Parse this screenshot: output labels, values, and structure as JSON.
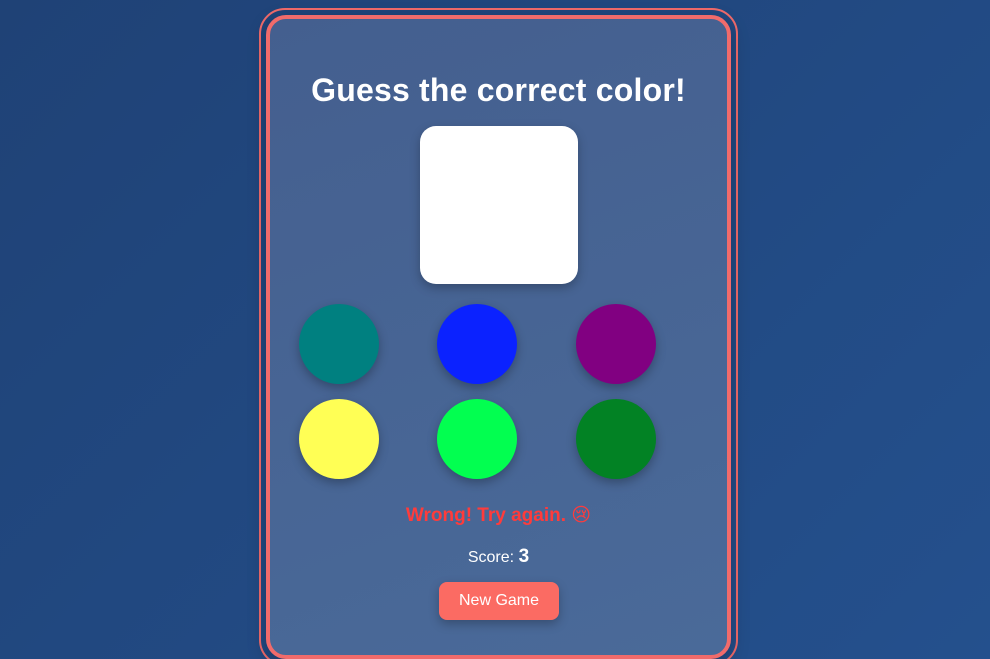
{
  "game": {
    "title": "Guess the correct color!",
    "target_color": "#ffffff",
    "options": [
      {
        "name": "teal",
        "color": "#008080"
      },
      {
        "name": "blue",
        "color": "#0b22ff"
      },
      {
        "name": "purple",
        "color": "#810081"
      },
      {
        "name": "yellow",
        "color": "#ffff55"
      },
      {
        "name": "bright-green",
        "color": "#02ff50"
      },
      {
        "name": "dark-green",
        "color": "#028224"
      }
    ],
    "message": "Wrong! Try again. 😢",
    "score_label": "Score:",
    "score_value": "3",
    "new_game_label": "New Game"
  },
  "theme": {
    "accent": "#f16b6b",
    "error_text": "#ff3b3b",
    "button": "#fb6b63"
  }
}
